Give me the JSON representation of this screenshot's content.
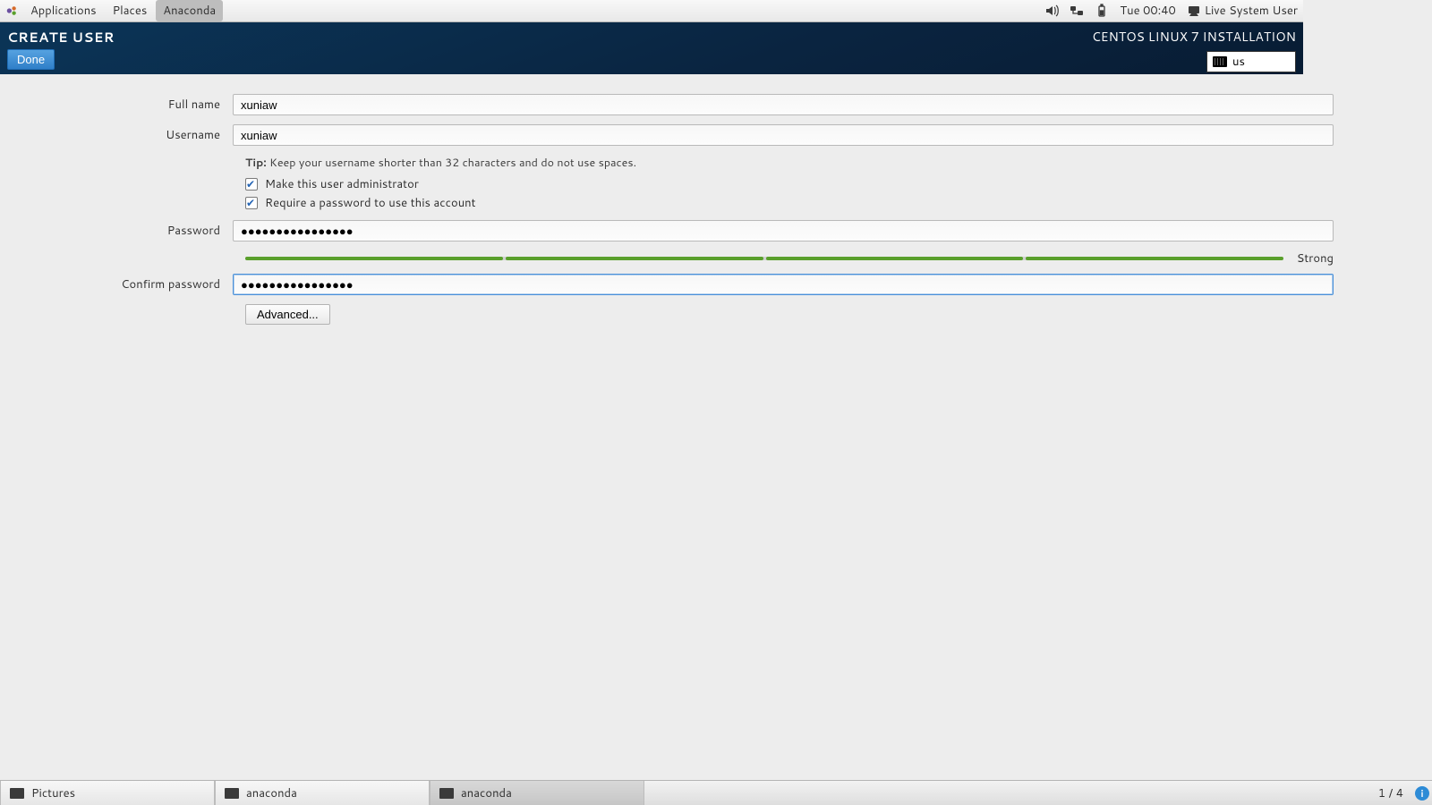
{
  "topbar": {
    "menu_applications": "Applications",
    "menu_places": "Places",
    "menu_appname": "Anaconda",
    "clock": "Tue 00:40",
    "user": "Live System User"
  },
  "header": {
    "title": "CREATE USER",
    "subtitle": "CENTOS LINUX 7 INSTALLATION",
    "done_label": "Done",
    "keyboard_layout": "us"
  },
  "form": {
    "fullname_label": "Full name",
    "fullname_value": "xuniaw",
    "username_label": "Username",
    "username_value": "xuniaw",
    "tip_prefix": "Tip:",
    "tip_text": " Keep your username shorter than 32 characters and do not use spaces.",
    "admin_label": "Make this user administrator",
    "admin_checked": true,
    "reqpw_label": "Require a password to use this account",
    "reqpw_checked": true,
    "password_label": "Password",
    "password_value": "●●●●●●●●●●●●●●●●",
    "strength_label": "Strong",
    "confirm_label": "Confirm password",
    "confirm_value": "●●●●●●●●●●●●●●●●",
    "advanced_label": "Advanced..."
  },
  "taskbar": {
    "tasks": [
      {
        "label": "Pictures",
        "active": false
      },
      {
        "label": "anaconda",
        "active": false
      },
      {
        "label": "anaconda",
        "active": true
      }
    ],
    "workspaces": "1 / 4"
  }
}
